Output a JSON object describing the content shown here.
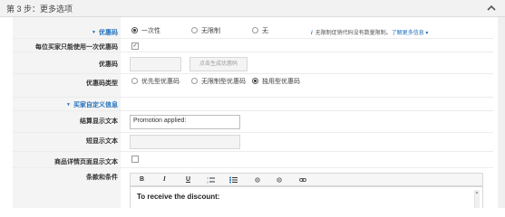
{
  "step": {
    "title": "第 3 步：更多选项",
    "collapse_icon": "chevron-up-icon"
  },
  "coupon_code": {
    "label": "优惠码",
    "options": [
      "一次性",
      "无限制",
      "无"
    ],
    "selected": "一次性",
    "note_text": "无限制促销代码没有数量限制。",
    "note_link": "了解更多信息"
  },
  "once_per_customer": {
    "label": "每位买家只能使用一次优惠码",
    "checked": true
  },
  "code_field": {
    "label": "优惠码",
    "value": "",
    "generate_button": "点击生成优惠码"
  },
  "code_type": {
    "label": "优惠码类型",
    "options": [
      "优先型优惠码",
      "无限制型优惠码",
      "独用型优惠码"
    ],
    "selected": "独用型优惠码"
  },
  "custom_messages": {
    "label": "买家自定义信息"
  },
  "checkout_display": {
    "label": "结算显示文本",
    "value": "Promotion applied:"
  },
  "short_display": {
    "label": "短显示文本",
    "value": ""
  },
  "detail_page_display": {
    "label": "商品详情页面显示文本",
    "checked": false
  },
  "terms": {
    "label": "条款和条件",
    "toolbar": [
      "B",
      "I",
      "U",
      "ordered-list-icon",
      "unordered-list-icon",
      "indent-icon",
      "outdent-icon",
      "link-icon"
    ],
    "content": "To receive the discount:"
  }
}
